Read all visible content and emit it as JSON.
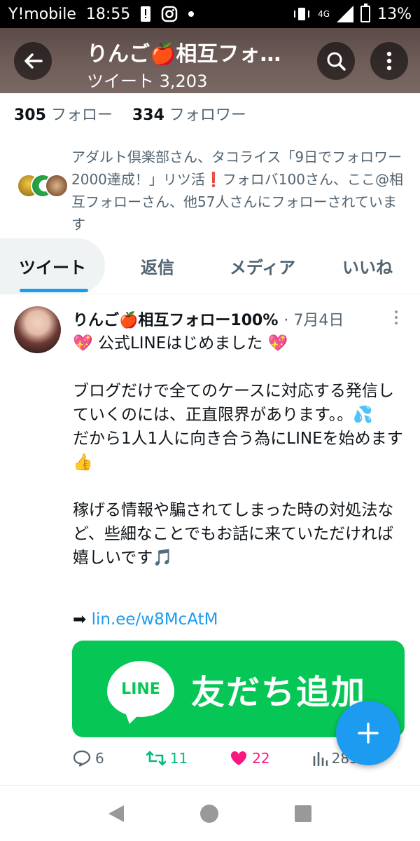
{
  "status_bar": {
    "carrier": "Y!mobile",
    "time": "18:55",
    "network": "4G",
    "battery": "13%"
  },
  "header": {
    "title": "りんご🍎相互フォ…",
    "tweet_count": "ツイート 3,203"
  },
  "follow": {
    "following_count": "305",
    "following_label": "フォロー",
    "followers_count": "334",
    "followers_label": "フォロワー"
  },
  "followed_by": {
    "text": "アダルト倶楽部さん、タコライス「9日でフォロワー2000達成！」リツ活❗フォロバ100さん、ここ@相互フォローさん、他57人さんにフォローされています"
  },
  "tabs": [
    {
      "label": "ツイート"
    },
    {
      "label": "返信"
    },
    {
      "label": "メディア"
    },
    {
      "label": "いいね"
    }
  ],
  "tweet": {
    "author": "りんご🍎相互フォロー100%",
    "date": "· 7月4日",
    "body": "💖 公式LINEはじめました 💖\n\nブログだけで全てのケースに対応する発信していくのには、正直限界があります。。💦\nだから1人1人に向き合う為にLINEを始めます👍\n\n稼げる情報や騙されてしまった時の対処法など、些細なことでもお話に来ていただければ嬉しいです🎵",
    "link_arrow": "➡",
    "link": "lin.ee/w8McAtM",
    "card": {
      "logo": "LINE",
      "text": "友だち追加"
    },
    "replies": "6",
    "retweets": "11",
    "likes": "22",
    "views": "285"
  },
  "colors": {
    "accent": "#1d9bf0",
    "line_green": "#06c755",
    "retweet": "#00ba7c",
    "like": "#f91880"
  }
}
